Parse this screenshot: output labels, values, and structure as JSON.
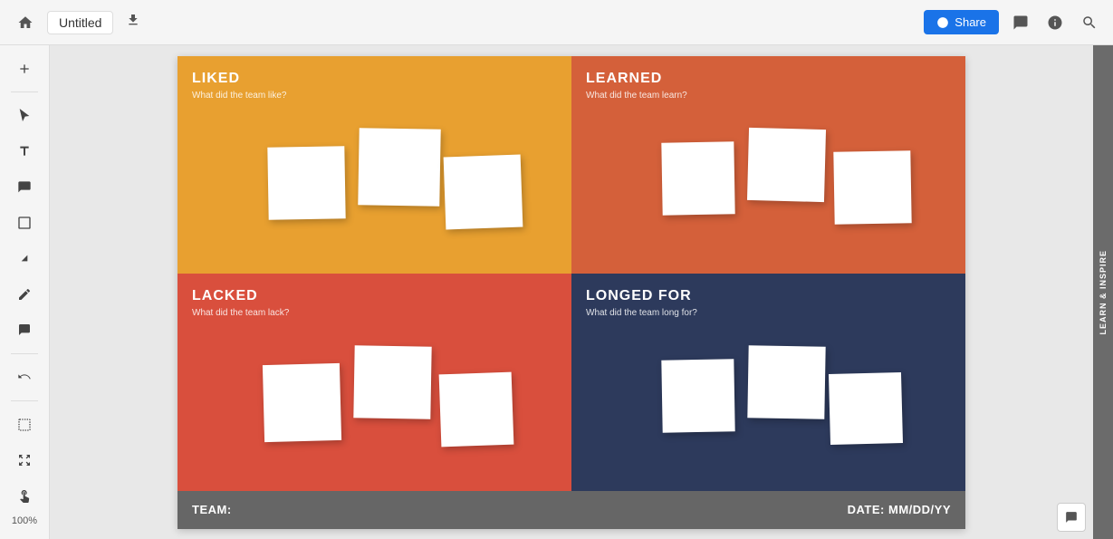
{
  "topbar": {
    "title": "Untitled",
    "upload_label": "⬆",
    "home_icon": "⌂",
    "share_label": "Share",
    "share_icon": "👤+",
    "chat_icon": "💬",
    "info_icon": "ℹ",
    "search_icon": "🔍"
  },
  "toolbar": {
    "tools": [
      {
        "name": "add",
        "icon": "+"
      },
      {
        "name": "select",
        "icon": "↖"
      },
      {
        "name": "text",
        "icon": "T"
      },
      {
        "name": "sticky",
        "icon": "▭"
      },
      {
        "name": "shape",
        "icon": "□"
      },
      {
        "name": "arrow",
        "icon": "↗"
      },
      {
        "name": "pen",
        "icon": "✏"
      },
      {
        "name": "comment",
        "icon": "💬"
      },
      {
        "name": "undo",
        "icon": "↩"
      }
    ],
    "view_tools": [
      {
        "name": "frame",
        "icon": "⊡"
      },
      {
        "name": "expand",
        "icon": "↗"
      },
      {
        "name": "hand",
        "icon": "✋"
      }
    ],
    "zoom": "100%"
  },
  "board": {
    "quadrants": [
      {
        "id": "liked",
        "title": "LIKED",
        "subtitle": "What did the team like?",
        "color": "#E8A030"
      },
      {
        "id": "learned",
        "title": "LEARNED",
        "subtitle": "What did the team learn?",
        "color": "#D4603A"
      },
      {
        "id": "lacked",
        "title": "LACKED",
        "subtitle": "What did the team lack?",
        "color": "#D94F3D"
      },
      {
        "id": "longed",
        "title": "LONGED FOR",
        "subtitle": "What did the team long for?",
        "color": "#2D3A5C"
      }
    ],
    "footer": {
      "team_label": "TEAM:",
      "date_label": "DATE: MM/DD/YY"
    }
  },
  "right_panel": {
    "label": "LEARN & INSPIRE"
  },
  "bottom": {
    "comment_icon": "💬"
  }
}
